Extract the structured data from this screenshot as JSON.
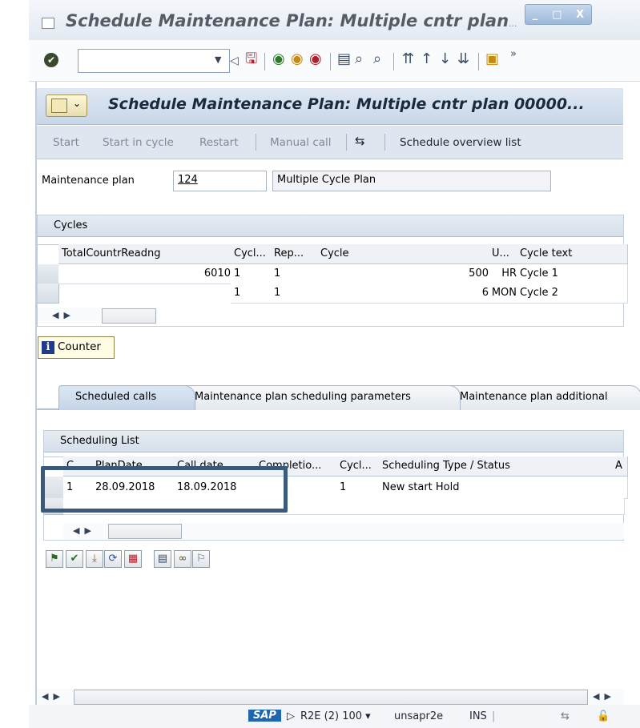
{
  "window": {
    "title": "Schedule Maintenance Plan: Multiple cntr plan",
    "title_overflow": "...",
    "controls": [
      "_",
      "□",
      "X"
    ]
  },
  "toolbar": {
    "command_value": "",
    "icons": [
      "enter-icon",
      "back-icon",
      "save-icon",
      "back-nav-icon",
      "exit-icon",
      "cancel-icon",
      "print-icon",
      "find-icon",
      "find-next-icon",
      "first-page-icon",
      "prev-page-icon",
      "next-page-icon",
      "last-page-icon",
      "layout-icon"
    ],
    "more": "»"
  },
  "header": {
    "title": "Schedule Maintenance Plan: Multiple cntr plan 00000..."
  },
  "appbar": {
    "start": "Start",
    "start_in_cycle": "Start in cycle",
    "restart": "Restart",
    "manual_call": "Manual call",
    "schedule_overview": "Schedule overview list"
  },
  "plan": {
    "label": "Maintenance plan",
    "number": "124",
    "description": "Multiple Cycle Plan"
  },
  "cycles": {
    "title": "Cycles",
    "columns": [
      "TotalCountrReadng",
      "Cycl...",
      "Rep...",
      "Cycle",
      "U...",
      "Cycle text"
    ],
    "rows": [
      {
        "total": "6010",
        "cycl": "1",
        "rep": "1",
        "cycle": "500",
        "unit": "HR",
        "text": "Cycle 1"
      },
      {
        "total": "",
        "cycl": "1",
        "rep": "1",
        "cycle": "6",
        "unit": "MON",
        "text": "Cycle 2"
      }
    ]
  },
  "counter_button": "Counter",
  "tabs": [
    {
      "label": "Scheduled calls",
      "active": true
    },
    {
      "label": "Maintenance plan scheduling parameters",
      "active": false
    },
    {
      "label": "Maintenance plan additional",
      "active": false
    }
  ],
  "scheduling": {
    "title": "Scheduling List",
    "columns": [
      "C...",
      "PlanDate",
      "Call date",
      "Completio...",
      "Cycl...",
      "Scheduling Type / Status",
      "A"
    ],
    "rows": [
      {
        "c": "1",
        "plan_date": "28.09.2018",
        "call_date": "18.09.2018",
        "completion": "",
        "cycl": "1",
        "type_status": "New start  Hold",
        "a": ""
      }
    ]
  },
  "statusbar": {
    "logo": "SAP",
    "system": "R2E (2) 100",
    "server": "unsapr2e",
    "mode": "INS"
  },
  "colors": {
    "header_band": "#c8d7e8",
    "highlight": "#3a5a7c",
    "logo_blue": "#1e66b0"
  }
}
